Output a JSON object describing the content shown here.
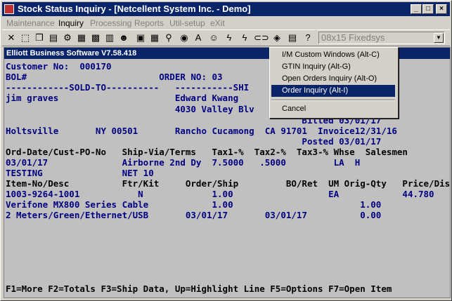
{
  "window": {
    "title": "Stock Status Inquiry - [Netcellent System Inc. - Demo]"
  },
  "menubar": [
    "Maintenance",
    "Inquiry",
    "Processing",
    "Reports",
    "Util-setup",
    "eXit"
  ],
  "toolbar": {
    "font_value": "08x15 Fixedsys"
  },
  "terminal": {
    "header": "Elliott Business Software V7.58.418",
    "lines": [
      "Customer No:  000170                                             Invce",
      "BOL#                         ORDER NO: 03                    R DATES--",
      "------------SOLD-TO----------   -----------SHI              103/01/17",
      "jim graves                      Edward Kwang                 ASAP",
      "                                4030 Valley Blv",
      "                                                        Billed 03/01/17",
      "Holtsville       NY 00501       Rancho Cucamong  CA 91701  Invoice12/31/16",
      "                                                        Posted 03/01/17",
      "Ord-Date/Cust-PO-No   Ship-Via/Terms   Tax1-%  Tax2-%  Tax3-% Whse  Salesmen",
      "03/01/17              Airborne 2nd Dy  7.5000   .5000         LA  H",
      "TESTING               NET 10",
      "Item-No/Desc          Ftr/Kit     Order/Ship         BO/Ret  UM Orig-Qty   Price/Dis",
      "1003-9264-1001           N             1.00                  EA            44.780",
      "Verifone MX800 Series Cable            1.00                        1.00",
      "2 Meters/Green/Ethernet/USB       03/01/17       03/01/17          0.00",
      "F1=More F2=Totals F3=Ship Data, Up=Highlight Line F5=Options F7=Open Item"
    ]
  },
  "popup_menu": {
    "items": [
      "I/M Custom Windows (Alt-C)",
      "GTIN Inquiry  (Alt-G)",
      "Open Orders Inquiry (Alt-O)",
      "Order Inquiry  (Alt-I)"
    ],
    "cancel": "Cancel"
  }
}
